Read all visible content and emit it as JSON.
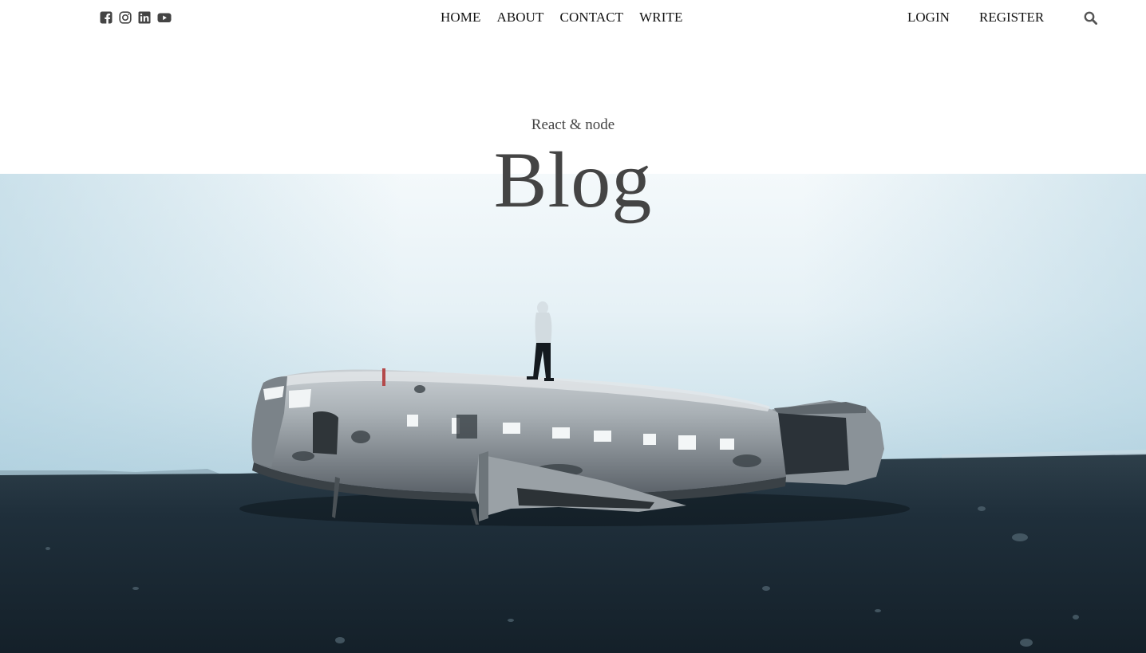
{
  "social": {
    "icons": [
      "facebook-square-icon",
      "instagram-icon",
      "linkedin-icon",
      "youtube-icon"
    ]
  },
  "nav": {
    "items": [
      "HOME",
      "ABOUT",
      "CONTACT",
      "WRITE"
    ]
  },
  "auth": {
    "login": "LOGIN",
    "register": "REGISTER"
  },
  "search": {
    "icon": "search-icon"
  },
  "header": {
    "subtitle": "React & node",
    "title": "Blog"
  },
  "hero": {
    "image": "crashed-plane-photo"
  },
  "colors": {
    "text": "#111111",
    "title": "#444444",
    "icon": "#444444",
    "sky": "#eaf3f7",
    "ground": "#1b2a35"
  }
}
